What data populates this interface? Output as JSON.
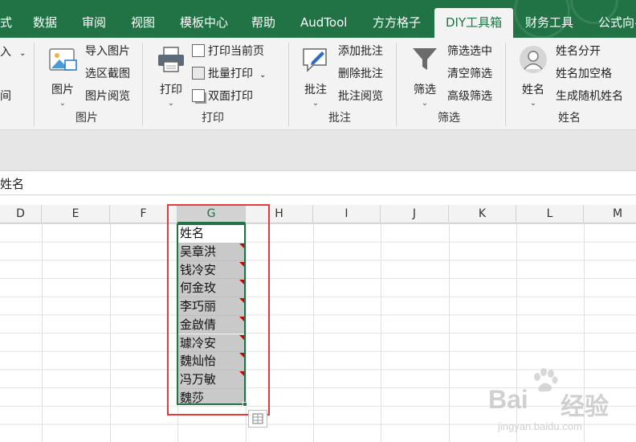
{
  "tabs": [
    {
      "id": "shi",
      "label": "式",
      "active": false
    },
    {
      "id": "shuju",
      "label": "数据",
      "active": false
    },
    {
      "id": "shenyue",
      "label": "审阅",
      "active": false
    },
    {
      "id": "shitu",
      "label": "视图",
      "active": false
    },
    {
      "id": "moban",
      "label": "模板中心",
      "active": false
    },
    {
      "id": "bangzhu",
      "label": "帮助",
      "active": false
    },
    {
      "id": "audtool",
      "label": "AudTool",
      "active": false
    },
    {
      "id": "fangfang",
      "label": "方方格子",
      "active": false
    },
    {
      "id": "diy",
      "label": "DIY工具箱",
      "active": true
    },
    {
      "id": "caiwu",
      "label": "财务工具",
      "active": false
    },
    {
      "id": "gongshi",
      "label": "公式向导",
      "active": false
    }
  ],
  "ribbon": {
    "partial": {
      "item1": "入",
      "item3": "间"
    },
    "picture": {
      "group_label": "图片",
      "big_label": "图片",
      "items": [
        "导入图片",
        "选区截图",
        "图片阅览"
      ]
    },
    "print": {
      "group_label": "打印",
      "big_label": "打印",
      "items": [
        "打印当前页",
        "批量打印",
        "双面打印"
      ]
    },
    "comment": {
      "group_label": "批注",
      "big_label": "批注",
      "items": [
        "添加批注",
        "删除批注",
        "批注阅览"
      ]
    },
    "filter": {
      "group_label": "筛选",
      "big_label": "筛选",
      "items": [
        "筛选选中",
        "清空筛选",
        "高级筛选"
      ]
    },
    "name": {
      "group_label": "姓名",
      "big_label": "姓名",
      "items": [
        "姓名分开",
        "姓名加空格",
        "生成随机姓名"
      ]
    }
  },
  "formula_bar": {
    "content": "姓名"
  },
  "columns": [
    {
      "label": "D",
      "selected": false
    },
    {
      "label": "E",
      "selected": false
    },
    {
      "label": "F",
      "selected": false
    },
    {
      "label": "G",
      "selected": true
    },
    {
      "label": "H",
      "selected": false
    },
    {
      "label": "I",
      "selected": false
    },
    {
      "label": "J",
      "selected": false
    },
    {
      "label": "K",
      "selected": false
    },
    {
      "label": "L",
      "selected": false
    },
    {
      "label": "M",
      "selected": false
    }
  ],
  "cells": {
    "header": "姓名",
    "names": [
      "吴章洪",
      "钱冷安",
      "何金玫",
      "李巧丽",
      "金啟倩",
      "璩冷安",
      "魏灿怡",
      "冯万敏",
      "魏莎"
    ]
  },
  "watermark": {
    "line1": "Bai",
    "line2": "经验",
    "url": "jingyan.baidu.com"
  },
  "colors": {
    "accent": "#217346",
    "highlight": "#e23b3b",
    "comment_marker": "#d40000",
    "selected_fill": "#c9c9c9"
  }
}
